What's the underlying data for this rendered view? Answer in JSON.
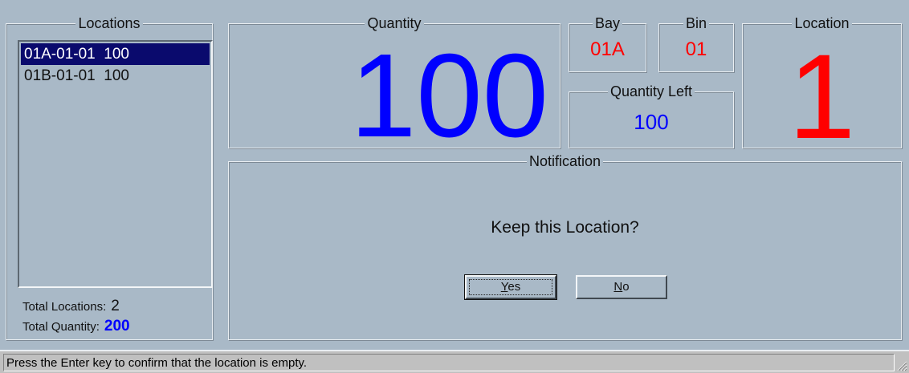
{
  "locations": {
    "title": "Locations",
    "items": [
      {
        "label": "01A-01-01  100"
      },
      {
        "label": "01B-01-01  100"
      }
    ],
    "total_locations_label": "Total Locations:",
    "total_locations_value": "2",
    "total_quantity_label": "Total Quantity:",
    "total_quantity_value": "200"
  },
  "quantity": {
    "title": "Quantity",
    "value": "100"
  },
  "bay": {
    "title": "Bay",
    "value": "01A"
  },
  "bin": {
    "title": "Bin",
    "value": "01"
  },
  "quantity_left": {
    "title": "Quantity Left",
    "value": "100"
  },
  "location": {
    "title": "Location",
    "value": "1"
  },
  "notification": {
    "title": "Notification",
    "message": "Keep this Location?",
    "yes_label": "Yes",
    "yes_mnemonic": "Y",
    "yes_rest": "es",
    "no_label": "No",
    "no_mnemonic": "N",
    "no_rest": "o"
  },
  "status": {
    "text": "Press the Enter key to confirm that the location is empty."
  },
  "colors": {
    "background": "#a9b9c7",
    "blue": "#0000ff",
    "red": "#ff0000",
    "selection": "#0a0a6d"
  }
}
